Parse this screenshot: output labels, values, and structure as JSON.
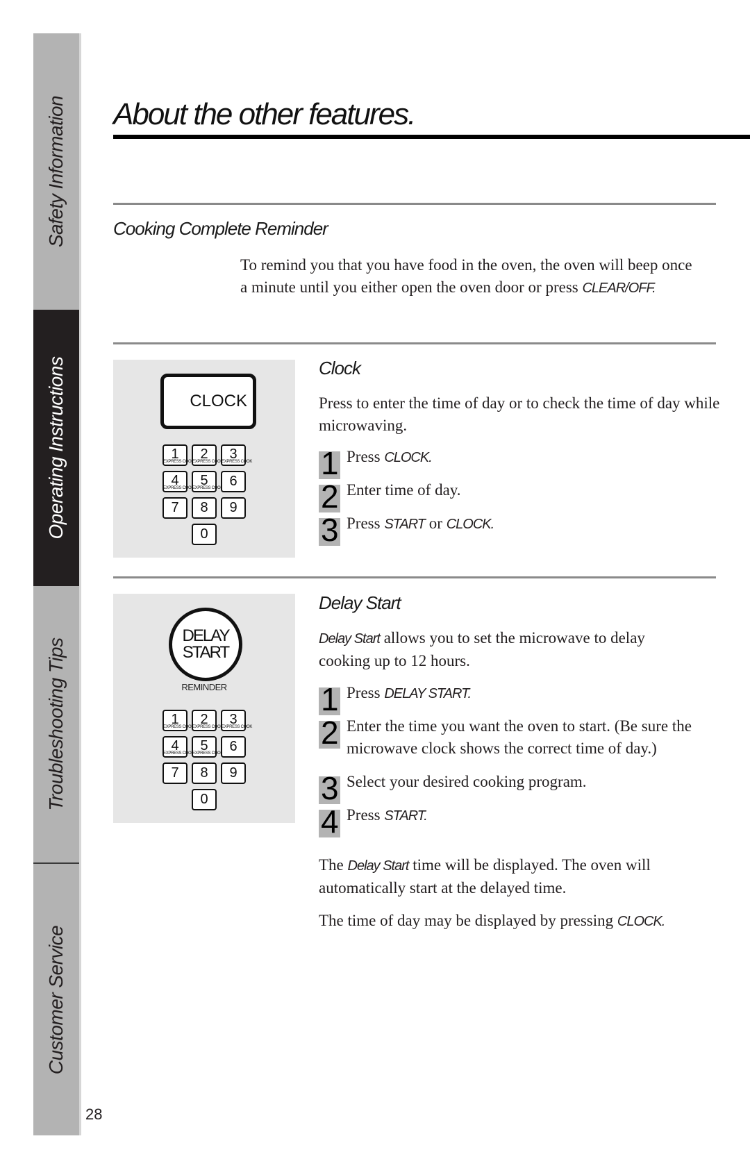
{
  "side_tabs": [
    {
      "label": "Safety Information",
      "active": false
    },
    {
      "label": "Operating Instructions",
      "active": true
    },
    {
      "label": "Troubleshooting Tips",
      "active": false
    },
    {
      "label": "Customer Service",
      "active": false
    }
  ],
  "page_number": "28",
  "title": "About the other features.",
  "cooking_complete": {
    "heading": "Cooking Complete Reminder",
    "text_before": "To remind you that you have food in the oven, the oven will beep once a minute until you either open the oven door or press ",
    "text_key": "CLEAR/OFF."
  },
  "clock": {
    "heading": "Clock",
    "key_label": "CLOCK",
    "description": "Press to enter the time of day or to check the time of day while microwaving.",
    "steps": [
      {
        "num": "1",
        "text": "Press ",
        "key": "CLOCK.",
        "after": ""
      },
      {
        "num": "2",
        "text": "Enter time of day.",
        "key": "",
        "after": ""
      },
      {
        "num": "3",
        "text": "Press ",
        "key": "START",
        "after": " or ",
        "key2": "CLOCK."
      }
    ]
  },
  "keypad": {
    "keys": [
      "1",
      "2",
      "3",
      "4",
      "5",
      "6",
      "7",
      "8",
      "9",
      "0"
    ],
    "sub_label": "EXPRESS COOK"
  },
  "delay_start": {
    "heading": "Delay Start",
    "key_line1": "DELAY",
    "key_line2": "START",
    "reminder_label": "REMINDER",
    "intro_key": "Delay Start",
    "intro_text": " allows you to set the microwave to delay cooking up to 12 hours.",
    "steps": [
      {
        "num": "1",
        "text": "Press ",
        "key": "DELAY START."
      },
      {
        "num": "2",
        "text": "Enter the time you want the oven to start. (Be sure the microwave clock shows the correct time of day.)",
        "key": ""
      },
      {
        "num": "3",
        "text": "Select your desired cooking program.",
        "key": ""
      },
      {
        "num": "4",
        "text": "Press ",
        "key": "START."
      }
    ],
    "note1_before": "The ",
    "note1_key": "Delay Start",
    "note1_after": " time will be displayed. The oven will automatically start at the delayed time.",
    "note2_before": "The time of day may be displayed by pressing ",
    "note2_key": "CLOCK."
  }
}
